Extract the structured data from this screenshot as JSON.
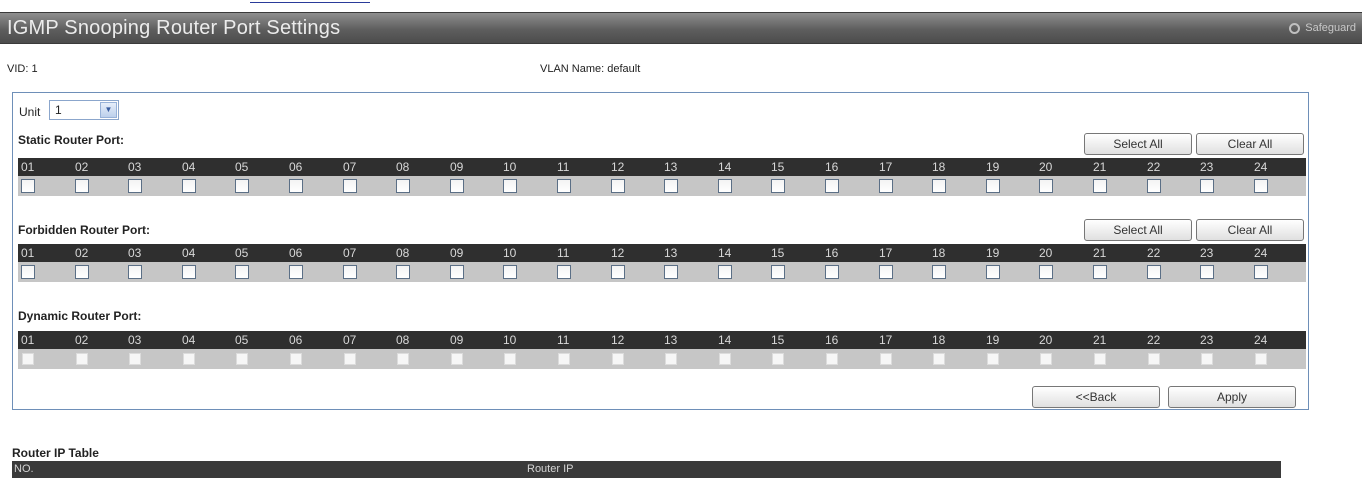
{
  "page": {
    "title": "IGMP Snooping Router Port Settings",
    "safeguard_label": "Safeguard"
  },
  "info": {
    "vid_label": "VID:",
    "vid_value": "1",
    "vlan_name_label": "VLAN Name:",
    "vlan_name_value": "default"
  },
  "unit": {
    "label": "Unit",
    "selected": "1"
  },
  "ports": [
    "01",
    "02",
    "03",
    "04",
    "05",
    "06",
    "07",
    "08",
    "09",
    "10",
    "11",
    "12",
    "13",
    "14",
    "15",
    "16",
    "17",
    "18",
    "19",
    "20",
    "21",
    "22",
    "23",
    "24"
  ],
  "sections": {
    "static": {
      "title": "Static Router Port:",
      "select_all": "Select All",
      "clear_all": "Clear All"
    },
    "forbidden": {
      "title": "Forbidden Router Port:",
      "select_all": "Select All",
      "clear_all": "Clear All"
    },
    "dynamic": {
      "title": "Dynamic Router Port:"
    }
  },
  "actions": {
    "back": "<<Back",
    "apply": "Apply"
  },
  "router_ip_table": {
    "title": "Router IP Table",
    "columns": [
      "NO.",
      "Router IP"
    ]
  },
  "colors": {
    "title_bar": "#5e5e5e",
    "panel_border": "#6e8fb8",
    "port_header_bg": "#2f2f2f",
    "port_row_bg": "#c6c6c6"
  }
}
